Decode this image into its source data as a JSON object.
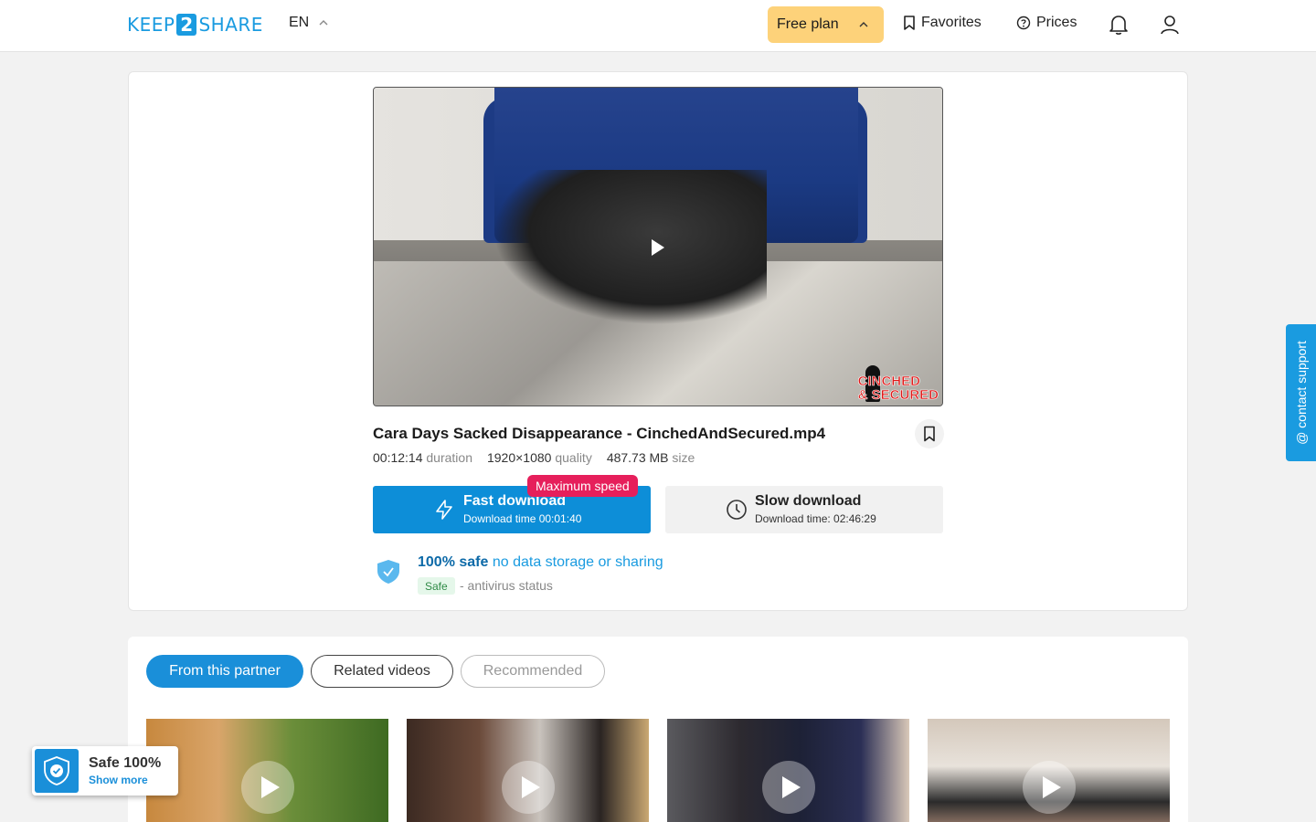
{
  "header": {
    "logo_left": "KEEP",
    "logo_num": "2",
    "logo_right": "SHARE",
    "language": "EN",
    "plan_label": "Free plan",
    "favorites_label": "Favorites",
    "prices_label": "Prices"
  },
  "video": {
    "watermark_line1": "CINCHED",
    "watermark_line2": "& SECURED",
    "title": "Cara Days Sacked Disappearance - CinchedAndSecured.mp4",
    "duration_value": "00:12:14",
    "duration_label": "duration",
    "quality_value": "1920×1080",
    "quality_label": "quality",
    "size_value": "487.73 MB",
    "size_label": "size"
  },
  "download": {
    "badge": "Maximum speed",
    "fast_title": "Fast download",
    "fast_subtitle": "Download time 00:01:40",
    "slow_title": "Slow download",
    "slow_subtitle": "Download time: 02:46:29"
  },
  "safety": {
    "headline_bold": "100% safe",
    "headline_rest": " no data storage or sharing",
    "pill": "Safe",
    "status": "- antivirus status"
  },
  "tabs": [
    {
      "label": "From this partner",
      "active": true
    },
    {
      "label": "Related videos",
      "active": false
    },
    {
      "label": "Recommended",
      "active": false
    }
  ],
  "contact_support": "@ contact support",
  "safe_widget": {
    "title": "Safe 100%",
    "link": "Show more"
  },
  "colors": {
    "accent": "#1a9be0",
    "plan": "#fdd27a",
    "badge": "#e61f5b"
  }
}
